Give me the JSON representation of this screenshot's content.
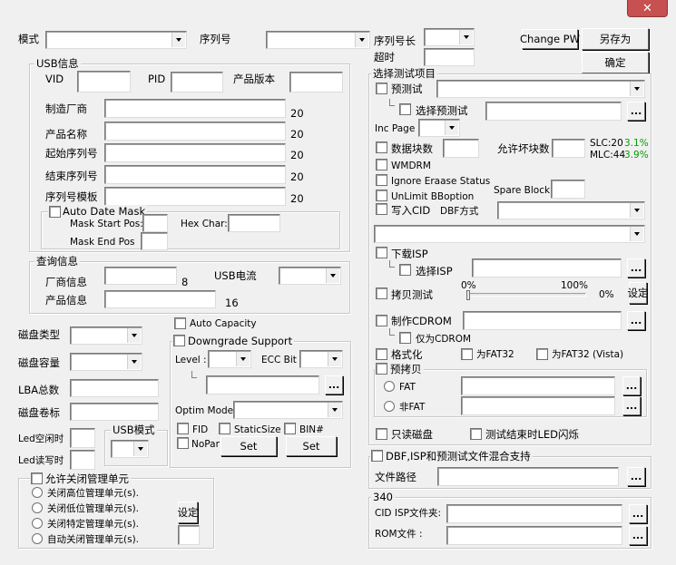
{
  "window": {
    "close_glyph": "✕"
  },
  "top": {
    "mode_label": "模式",
    "serial_label": "序列号",
    "serial_len_label": "序列号长",
    "timeout_label": "超时",
    "change_pw": "Change PW",
    "save_as": "另存为",
    "ok": "确定"
  },
  "usb_info": {
    "title": "USB信息",
    "vid": "VID",
    "pid": "PID",
    "version": "产品版本",
    "manufacturer": "制造厂商",
    "product_name": "产品名称",
    "start_serial": "起始序列号",
    "end_serial": "结束序列号",
    "serial_template": "序列号模板",
    "n20": "20",
    "auto_date_mask": "Auto Date Mask",
    "mask_start": "Mask Start Pos:",
    "mask_end": "Mask End Pos",
    "hex_char": "Hex Char:"
  },
  "query": {
    "title": "查询信息",
    "vendor": "厂商信息",
    "vendor_len": "8",
    "usb_current": "USB电流",
    "product": "产品信息",
    "product_len": "16"
  },
  "disk": {
    "type": "磁盘类型",
    "capacity": "磁盘容量",
    "lba": "LBA总数",
    "label": "磁盘卷标",
    "led_idle": "Led空闲时",
    "led_rw": "Led读写时",
    "usb_mode": "USB模式"
  },
  "mgmt": {
    "allow_close": "允许关闭管理单元",
    "close_high": "关闭高位管理单元(s).",
    "close_low": "关闭低位管理单元(s).",
    "close_specific": "关闭特定管理单元(s).",
    "auto_close": "自动关闭管理单元(s).",
    "set": "设定"
  },
  "mid": {
    "auto_capacity": "Auto Capacity",
    "downgrade": "Downgrade Support",
    "level": "Level :",
    "ecc_bit": "ECC Bit :",
    "optim_mode": "Optim Mode :",
    "fid": "FID",
    "static_size": "StaticSize",
    "bin": "BIN#",
    "nopar": "NoPar",
    "set": "Set",
    "dots": "..."
  },
  "test": {
    "title": "选择测试项目",
    "pretest": "预测试",
    "select_pretest": "选择预测试",
    "inc_page": "Inc Page",
    "data_blocks": "数据块数",
    "allow_bad": "允许坏块数",
    "slc": "SLC:20",
    "slc_pct": "3.1%",
    "mlc": "MLC:44",
    "mlc_pct": "3.9%",
    "wmdrm": "WMDRM",
    "ignore_erase": "Ignore Eraase Status",
    "unlimit": "UnLimit BBoption",
    "spare_block": "Spare Block",
    "write_cid": "写入CID",
    "dbf_mode": "DBF方式",
    "download_isp": "下载ISP",
    "select_isp": "选择ISP",
    "copy_test": "拷贝测试",
    "pct0": "0%",
    "pct100": "100%",
    "pct_now": "0%",
    "set": "设定",
    "make_cdrom": "制作CDROM",
    "only_cdrom": "仅为CDROM",
    "format": "格式化",
    "fat32": "为FAT32",
    "fat32_vista": "为FAT32 (Vista)",
    "precopy": "预拷贝",
    "fat": "FAT",
    "nonfat": "非FAT",
    "readonly": "只读磁盘",
    "led_flash": "测试结束时LED闪烁",
    "dots": "..."
  },
  "dbf": {
    "title": "DBF,ISP和预测试文件混合支持",
    "file_path": "文件路径"
  },
  "g340": {
    "title": "340",
    "cid_isp": "CID ISP文件夹:",
    "rom": "ROM文件 :"
  },
  "colors": {
    "accent_green": "#00a000",
    "close_red": "#c75050"
  },
  "icons": [
    "close-icon",
    "dropdown-arrow-icon",
    "checkbox-icon",
    "radio-icon"
  ]
}
